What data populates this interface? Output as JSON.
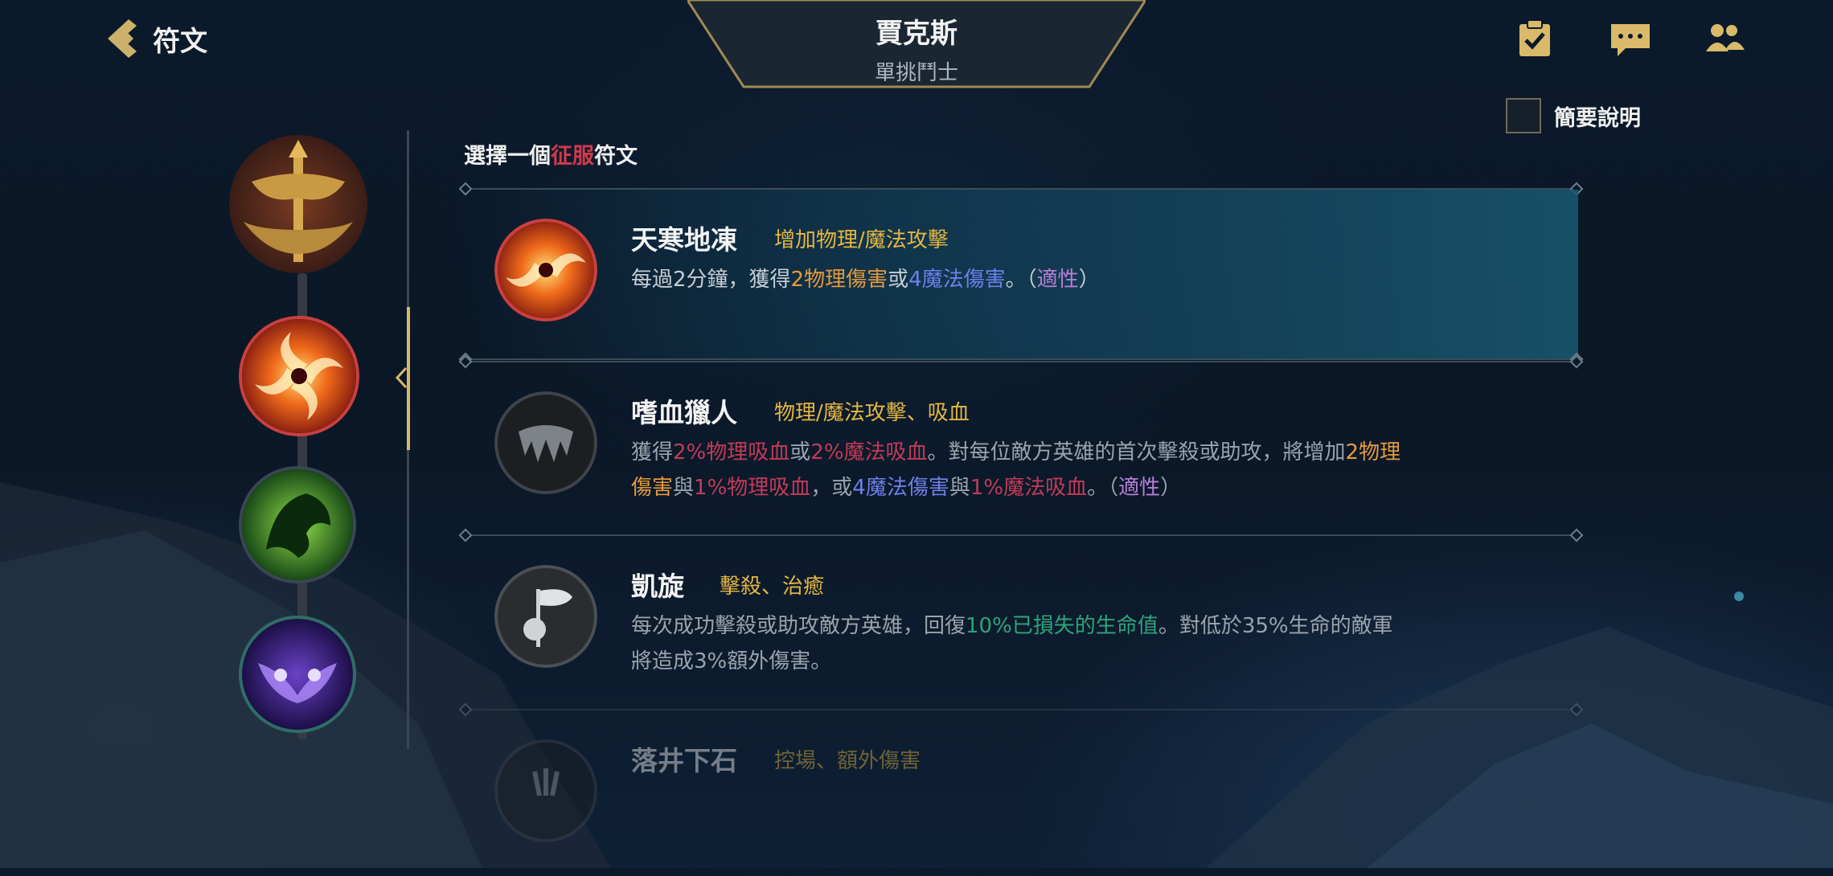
{
  "header": {
    "back_label": "符文",
    "champion_name": "賈克斯",
    "champion_role": "單挑鬥士",
    "icons": [
      "checklist-icon",
      "chat-icon",
      "friends-icon"
    ]
  },
  "brief_toggle": {
    "label": "簡要說明",
    "checked": false
  },
  "prompt": {
    "prefix": "選擇一個",
    "highlight": "征服",
    "suffix": "符文"
  },
  "runes": [
    {
      "name": "天寒地凍",
      "tags": "增加物理/魔法攻擊",
      "desc": [
        {
          "t": "每過2分鐘，獲得"
        },
        {
          "t": "2物理傷害",
          "c": "c-orange"
        },
        {
          "t": "或"
        },
        {
          "t": "4魔法傷害",
          "c": "c-blue"
        },
        {
          "t": "。（"
        },
        {
          "t": "適性",
          "c": "c-purple"
        },
        {
          "t": "）"
        }
      ],
      "selected": true
    },
    {
      "name": "嗜血獵人",
      "tags": "物理/魔法攻擊、吸血",
      "desc": [
        {
          "t": "獲得"
        },
        {
          "t": "2%物理吸血",
          "c": "c-red"
        },
        {
          "t": "或"
        },
        {
          "t": "2%魔法吸血",
          "c": "c-red"
        },
        {
          "t": "。對每位敵方英雄的首次擊殺或助攻，將增加"
        },
        {
          "t": "2物理傷害",
          "c": "c-orange"
        },
        {
          "t": "與"
        },
        {
          "t": "1%物理吸血",
          "c": "c-red"
        },
        {
          "t": "，或"
        },
        {
          "t": "4魔法傷害",
          "c": "c-blue"
        },
        {
          "t": "與"
        },
        {
          "t": "1%魔法吸血",
          "c": "c-red"
        },
        {
          "t": "。（"
        },
        {
          "t": "適性",
          "c": "c-purple"
        },
        {
          "t": "）"
        }
      ],
      "selected": false
    },
    {
      "name": "凱旋",
      "tags": "擊殺、治癒",
      "desc": [
        {
          "t": "每次成功擊殺或助攻敵方英雄，回復"
        },
        {
          "t": "10%已損失的生命值",
          "c": "c-green"
        },
        {
          "t": "。對低於35%生命的敵軍將造成3%額外傷害。"
        }
      ],
      "selected": false
    },
    {
      "name": "落井下石",
      "tags": "控場、額外傷害",
      "desc": [],
      "selected": false
    }
  ],
  "tree_nodes": [
    "conqueror-keystone-icon",
    "frost-rune-icon",
    "bloodhunter-icon",
    "triumph-icon",
    "sorcery-icon"
  ]
}
